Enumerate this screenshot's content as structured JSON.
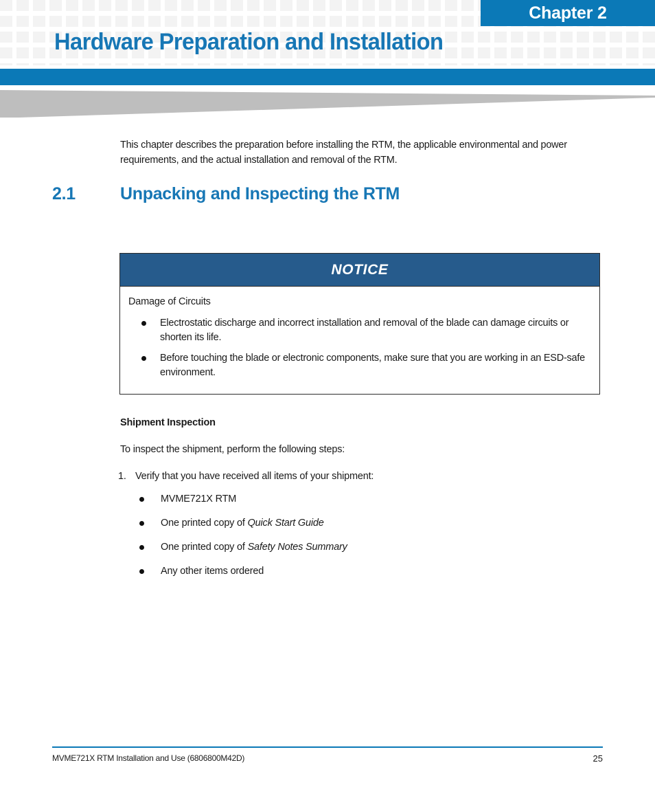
{
  "header": {
    "chapter_banner": "Chapter 2",
    "chapter_title": "Hardware Preparation and Installation",
    "accent_color": "#0B79B7",
    "title_color": "#1777B5",
    "pattern_color": "#F3F3F3",
    "swoosh_color": "#BEBEBE"
  },
  "body": {
    "intro_paragraph": "This chapter describes the preparation before installing the RTM, the applicable environmental and power requirements, and the actual installation and removal of the RTM.",
    "section": {
      "number": "2.1",
      "title": "Unpacking and Inspecting the RTM"
    }
  },
  "notice": {
    "label": "NOTICE",
    "header_color": "#265B8C",
    "lead": "Damage of Circuits",
    "items": [
      "Electrostatic discharge and incorrect installation and removal of the blade can damage circuits or shorten its life.",
      "Before touching the blade or electronic components, make sure that you are working in an ESD-safe environment."
    ]
  },
  "shipment": {
    "heading": "Shipment Inspection",
    "intro": "To inspect the shipment, perform the following steps:",
    "step_number": "1.",
    "step_text": "Verify that you have received all items of your shipment:",
    "items": [
      {
        "text": "MVME721X RTM",
        "italic": ""
      },
      {
        "text": "One printed copy of ",
        "italic": "Quick Start Guide"
      },
      {
        "text": "One printed copy of ",
        "italic": "Safety Notes Summary"
      },
      {
        "text": "Any other items ordered",
        "italic": ""
      }
    ]
  },
  "footer": {
    "document_title": "MVME721X RTM Installation and Use (6806800M42D)",
    "page_number": "25",
    "rule_color": "#0B79B7"
  }
}
